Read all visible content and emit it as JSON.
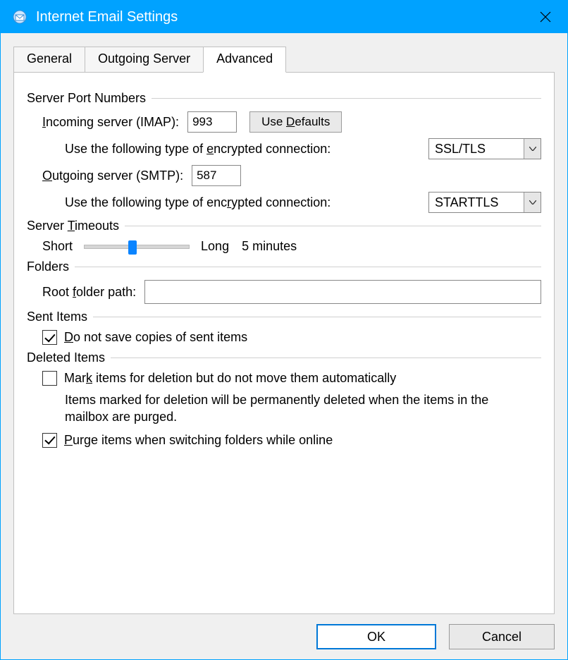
{
  "window": {
    "title": "Internet Email Settings"
  },
  "tabs": {
    "general": "General",
    "outgoing": "Outgoing Server",
    "advanced": "Advanced"
  },
  "groups": {
    "server_ports": "Server Port Numbers",
    "server_timeouts_pre": "Server ",
    "server_timeouts_u": "T",
    "server_timeouts_post": "imeouts",
    "folders": "Folders",
    "sent_items": "Sent Items",
    "deleted_items": "Deleted Items"
  },
  "labels": {
    "incoming_u": "I",
    "incoming_post": "ncoming server (IMAP):",
    "outgoing_u": "O",
    "outgoing_post": "utgoing server (SMTP):",
    "enc_pre": "Use the following type of ",
    "enc_u": "e",
    "enc_post": "ncrypted connection:",
    "enc2_pre": "Use the following type of enc",
    "enc2_u": "r",
    "enc2_post": "ypted connection:",
    "use_defaults_pre": "Use ",
    "use_defaults_u": "D",
    "use_defaults_post": "efaults",
    "short": "Short",
    "long": "Long",
    "timeout_value": "5 minutes",
    "root_pre": "Root ",
    "root_u": "f",
    "root_post": "older path:",
    "dont_save_u": "D",
    "dont_save_post": "o not save copies of sent items",
    "mark_pre": "Mar",
    "mark_u": "k",
    "mark_post": " items for deletion but do not move them automatically",
    "mark_help": "Items marked for deletion will be permanently deleted when the items in the mailbox are purged.",
    "purge_u": "P",
    "purge_post": "urge items when switching folders while online",
    "ok": "OK",
    "cancel": "Cancel"
  },
  "values": {
    "incoming_port": "993",
    "outgoing_port": "587",
    "incoming_enc": "SSL/TLS",
    "outgoing_enc": "STARTTLS",
    "root_folder": ""
  }
}
